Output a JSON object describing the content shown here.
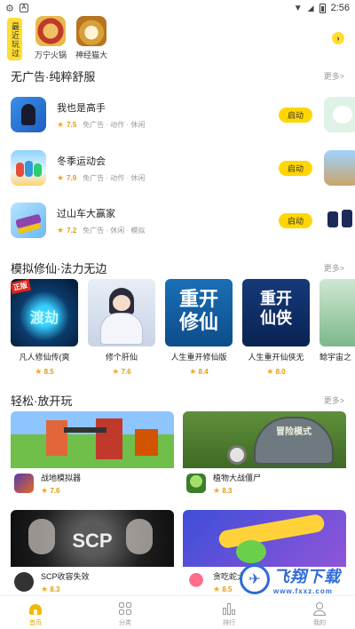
{
  "status_bar": {
    "time": "2:56",
    "notif_label": "A"
  },
  "recent": {
    "tag": "最近玩过",
    "items": [
      {
        "name": "万宁火锅"
      },
      {
        "name": "神经猫大"
      }
    ],
    "more_icon": "chevron-right-icon"
  },
  "sections": {
    "ad_free": {
      "title": "无广告·纯粹舒服",
      "more": "更多>"
    },
    "xiuxian": {
      "title": "模拟修仙·法力无边",
      "more": "更多>"
    },
    "relax": {
      "title": "轻松·放开玩",
      "more": "更多>"
    }
  },
  "apps": [
    {
      "name": "我也是高手",
      "rating": "7.5",
      "tags": "免广告 · 动作 · 休闲",
      "action": "启动"
    },
    {
      "name": "冬季运动会",
      "rating": "7.9",
      "tags": "免广告 · 动作 · 休闲",
      "action": "启动"
    },
    {
      "name": "过山车大赢家",
      "rating": "7.2",
      "tags": "免广告 · 休闲 · 模拟",
      "action": "启动"
    }
  ],
  "cards": [
    {
      "name": "凡人修仙传(爽",
      "rating": "8.5",
      "art_text": "渡劫",
      "badge": "正版"
    },
    {
      "name": "修个肝仙",
      "rating": "7.6"
    },
    {
      "name": "人生重开修仙版",
      "rating": "8.4",
      "art_text": "重开修仙"
    },
    {
      "name": "人生重开仙侠无",
      "rating": "8.0",
      "art_text": "重开仙侠"
    },
    {
      "name": "鲶宇宙之"
    }
  ],
  "tiles": [
    {
      "name": "战地模拟器",
      "rating": "7.6"
    },
    {
      "name": "植物大战僵尸",
      "rating": "8.3",
      "art_text": "冒险模式"
    },
    {
      "name": "SCP收容失效",
      "rating": "8.3",
      "art_text": "SCP"
    },
    {
      "name": "贪吃蛇大作战",
      "rating": "8.5"
    }
  ],
  "bottom_nav": [
    {
      "label": "首页",
      "icon": "home-icon",
      "active": true
    },
    {
      "label": "分类",
      "icon": "grid-icon",
      "active": false
    },
    {
      "label": "排行",
      "icon": "bar-chart-icon",
      "active": false
    },
    {
      "label": "我的",
      "icon": "user-icon",
      "active": false
    }
  ],
  "watermark": {
    "title": "飞翔下载",
    "url": "www.fxxz.com"
  },
  "colors": {
    "accent": "#ffd600",
    "rating": "#e09a10",
    "active_nav": "#e6a800"
  }
}
